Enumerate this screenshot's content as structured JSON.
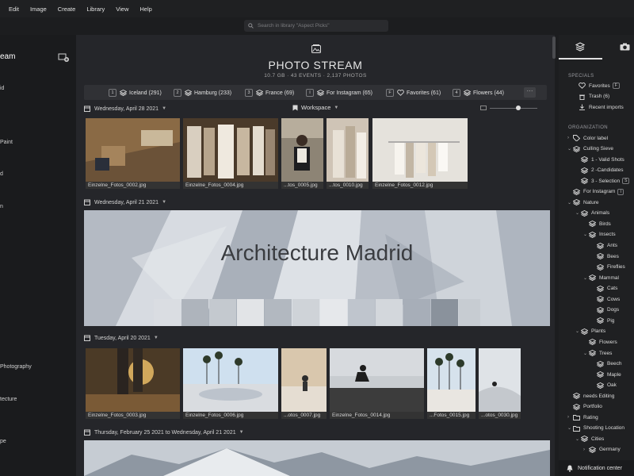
{
  "menu": [
    "Edit",
    "Image",
    "Create",
    "Library",
    "View",
    "Help"
  ],
  "search": {
    "placeholder": "Search in library \"Aspect Picks\""
  },
  "left_sidebar": {
    "items": [
      {
        "label": "eam",
        "active": true
      },
      {
        "label": "id"
      },
      {
        "label": "Paint"
      },
      {
        "label": "d"
      },
      {
        "label": "n"
      },
      {
        "label": "Photography"
      },
      {
        "label": "tecture"
      },
      {
        "label": "pe"
      }
    ]
  },
  "header": {
    "title": "PHOTO STREAM",
    "stats": "10.7 GB · 43 EVENTS · 2,137 PHOTOS"
  },
  "filters": [
    {
      "key": "1",
      "label": "Iceland (291)"
    },
    {
      "key": "2",
      "label": "Hamburg (233)"
    },
    {
      "key": "3",
      "label": "France (69)"
    },
    {
      "key": "I",
      "label": "For Instagram (65)"
    },
    {
      "key": "F",
      "label": "Favorites (61)"
    },
    {
      "key": "4",
      "label": "Flowers (44)"
    }
  ],
  "more_label": "···",
  "workspace_label": "Workspace",
  "sections": [
    {
      "date": "Wednesday, April 28 2021",
      "photos": [
        "Einzelne_Fotos_0002.jpg",
        "Einzelne_Fotos_0004.jpg",
        "...tos_0005.jpg",
        "...tos_0010.jpg",
        "Einzelne_Fotos_0012.jpg"
      ]
    },
    {
      "date": "Wednesday, April 21 2021",
      "banner_title": "Architecture Madrid"
    },
    {
      "date": "Tuesday, April 20 2021",
      "photos": [
        "Einzelne_Fotos_0003.jpg",
        "Einzelne_Fotos_0006.jpg",
        "...otos_0007.jpg",
        "Einzelne_Fotos_0014.jpg",
        "...Fotos_0015.jpg",
        "...otos_0030.jpg"
      ]
    },
    {
      "date": "Thursday, February 25 2021 to Wednesday, April 21 2021"
    }
  ],
  "right_panel": {
    "specials_label": "SPECIALS",
    "specials": [
      {
        "label": "Favorites",
        "kbd": "F",
        "icon": "heart-icon"
      },
      {
        "label": "Trash (6)",
        "icon": "trash-icon"
      },
      {
        "label": "Recent imports",
        "icon": "import-icon"
      }
    ],
    "organization_label": "ORGANIZATION",
    "tree": [
      {
        "label": "Color label",
        "depth": 0,
        "arrow": "›",
        "icon": "tag-icon"
      },
      {
        "label": "Culling Sieve",
        "depth": 0,
        "arrow": "⌄",
        "icon": "stack-icon"
      },
      {
        "label": "1 - Valid Shots",
        "depth": 1,
        "icon": "stack-icon"
      },
      {
        "label": "2 -Candidates",
        "depth": 1,
        "icon": "stack-icon"
      },
      {
        "label": "3 - Selection",
        "depth": 1,
        "kbd": "S",
        "icon": "stack-icon"
      },
      {
        "label": "For Instagram",
        "depth": 0,
        "kbd": "I",
        "icon": "stack-icon"
      },
      {
        "label": "Nature",
        "depth": 0,
        "arrow": "⌄",
        "icon": "stack-icon"
      },
      {
        "label": "Animals",
        "depth": 1,
        "arrow": "⌄",
        "icon": "stack-icon"
      },
      {
        "label": "Birds",
        "depth": 2,
        "icon": "stack-icon"
      },
      {
        "label": "Insects",
        "depth": 2,
        "arrow": "⌄",
        "icon": "stack-icon"
      },
      {
        "label": "Ants",
        "depth": 3,
        "icon": "stack-icon"
      },
      {
        "label": "Bees",
        "depth": 3,
        "icon": "stack-icon"
      },
      {
        "label": "Fireflies",
        "depth": 3,
        "icon": "stack-icon"
      },
      {
        "label": "Mammal",
        "depth": 2,
        "arrow": "⌄",
        "icon": "stack-icon"
      },
      {
        "label": "Cats",
        "depth": 3,
        "icon": "stack-icon"
      },
      {
        "label": "Cows",
        "depth": 3,
        "icon": "stack-icon"
      },
      {
        "label": "Dogs",
        "depth": 3,
        "icon": "stack-icon"
      },
      {
        "label": "Pig",
        "depth": 3,
        "icon": "stack-icon"
      },
      {
        "label": "Plants",
        "depth": 1,
        "arrow": "⌄",
        "icon": "stack-icon"
      },
      {
        "label": "Flowers",
        "depth": 2,
        "icon": "stack-icon"
      },
      {
        "label": "Trees",
        "depth": 2,
        "arrow": "⌄",
        "icon": "stack-icon"
      },
      {
        "label": "Beech",
        "depth": 3,
        "icon": "stack-icon"
      },
      {
        "label": "Maple",
        "depth": 3,
        "icon": "stack-icon"
      },
      {
        "label": "Oak",
        "depth": 3,
        "icon": "stack-icon"
      },
      {
        "label": "needs Editing",
        "depth": 0,
        "icon": "stack-icon"
      },
      {
        "label": "Portfolio",
        "depth": 0,
        "icon": "stack-icon"
      },
      {
        "label": "Rating",
        "depth": 0,
        "arrow": "›",
        "icon": "folder-icon"
      },
      {
        "label": "Shooting Location",
        "depth": 0,
        "arrow": "⌄",
        "icon": "folder-icon"
      },
      {
        "label": "Cities",
        "depth": 1,
        "arrow": "⌄",
        "icon": "stack-icon"
      },
      {
        "label": "Germany",
        "depth": 2,
        "arrow": "›",
        "icon": "stack-icon"
      }
    ],
    "notification_label": "Notification center"
  }
}
